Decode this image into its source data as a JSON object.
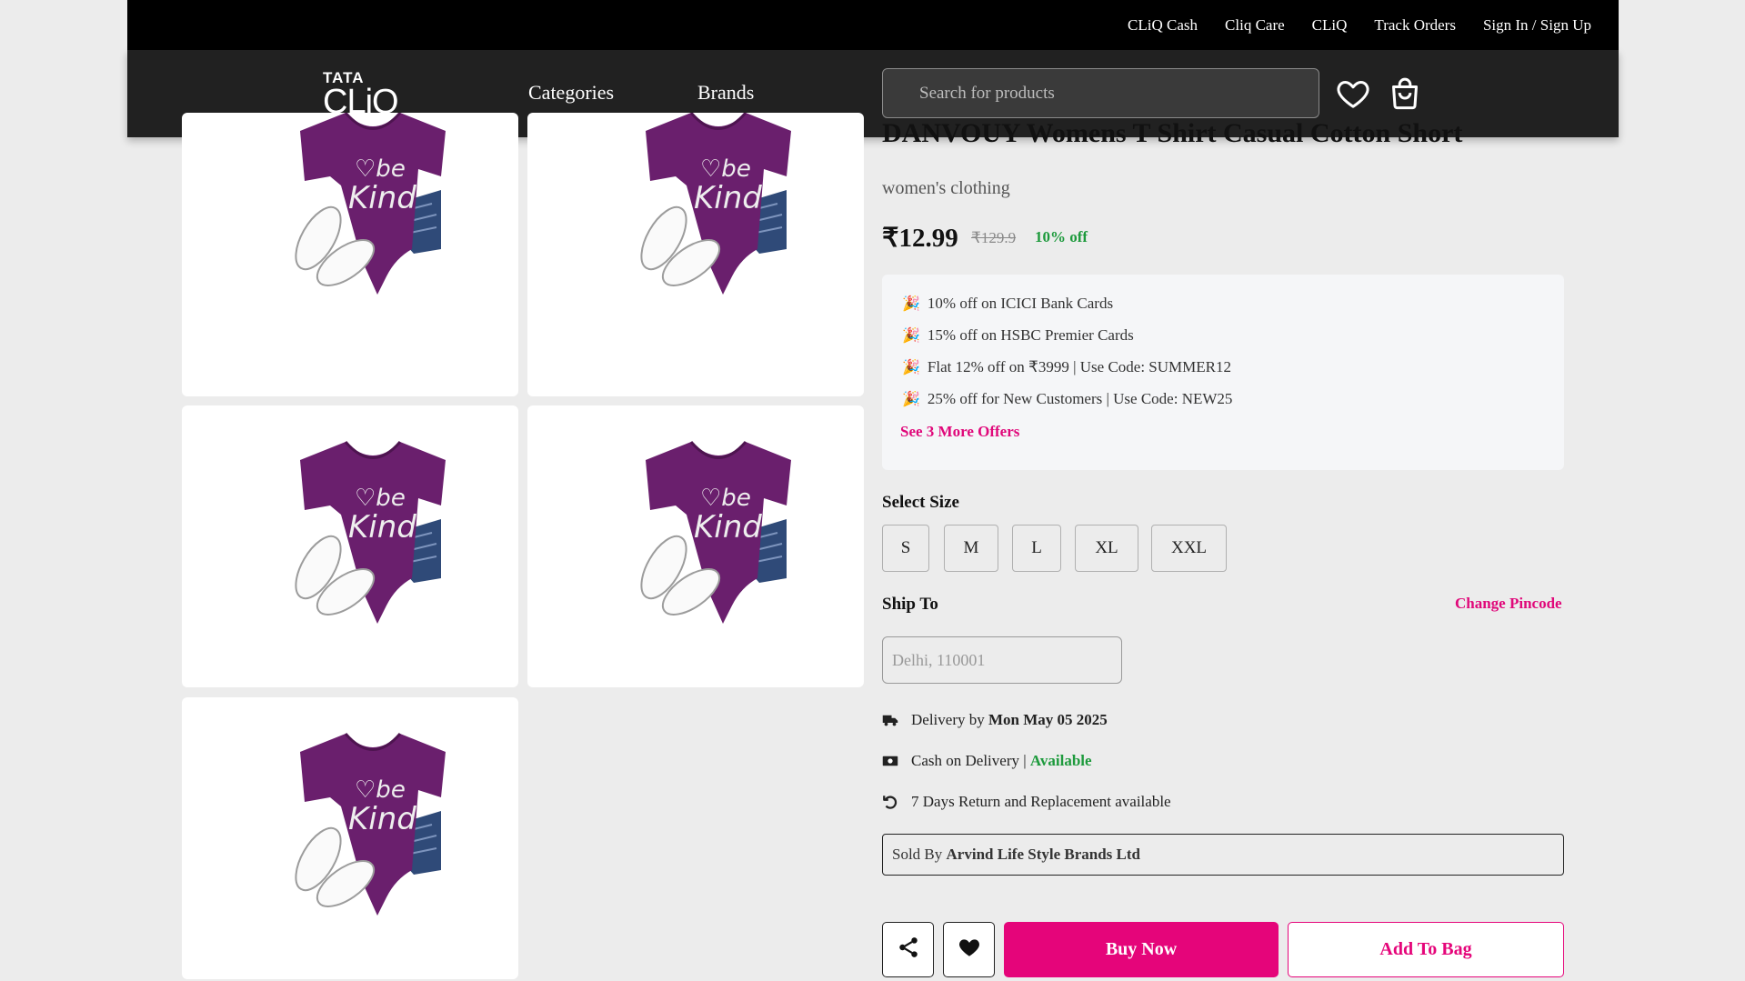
{
  "topbar": {
    "links": [
      "CLiQ Cash",
      "Cliq Care",
      "CLiQ",
      "Track Orders",
      "Sign In / Sign Up"
    ]
  },
  "header": {
    "logo_top": "TATA",
    "logo_bottom": "CLiQ",
    "nav": [
      "Categories",
      "Brands"
    ],
    "search_placeholder": "Search for products",
    "icons": [
      "heart-icon",
      "bag-icon"
    ]
  },
  "gallery": {
    "image_alt": "be kind",
    "count": 5
  },
  "product": {
    "title": "DANVOUY Womens T Shirt Casual Cotton Short",
    "category": "women's clothing",
    "price": "₹12.99",
    "mrp": "₹129.9",
    "discount": "10% off"
  },
  "offers": {
    "items": [
      "10% off on ICICI Bank Cards",
      "15% off on HSBC Premier Cards",
      "Flat 12% off on ₹3999 | Use Code: SUMMER12",
      "25% off for New Customers | Use Code: NEW25"
    ],
    "more": "See 3 More Offers"
  },
  "size": {
    "label": "Select Size",
    "options": [
      "S",
      "M",
      "L",
      "XL",
      "XXL"
    ]
  },
  "ship": {
    "label": "Ship To",
    "change": "Change Pincode",
    "placeholder": "Delhi, 110001"
  },
  "delivery": {
    "prefix": "Delivery by ",
    "date": "Mon May 05 2025",
    "cod_label": "Cash on Delivery",
    "cod_sep": " | ",
    "cod_status": "Available",
    "returns": "7 Days Return and Replacement available"
  },
  "seller": {
    "prefix": "Sold By ",
    "name": "Arvind Life Style Brands Ltd"
  },
  "actions": {
    "buy": "Buy Now",
    "add": "Add To Bag"
  },
  "colors": {
    "accent": "#e5057a",
    "success": "#1d9a3c",
    "header": "#212121"
  }
}
